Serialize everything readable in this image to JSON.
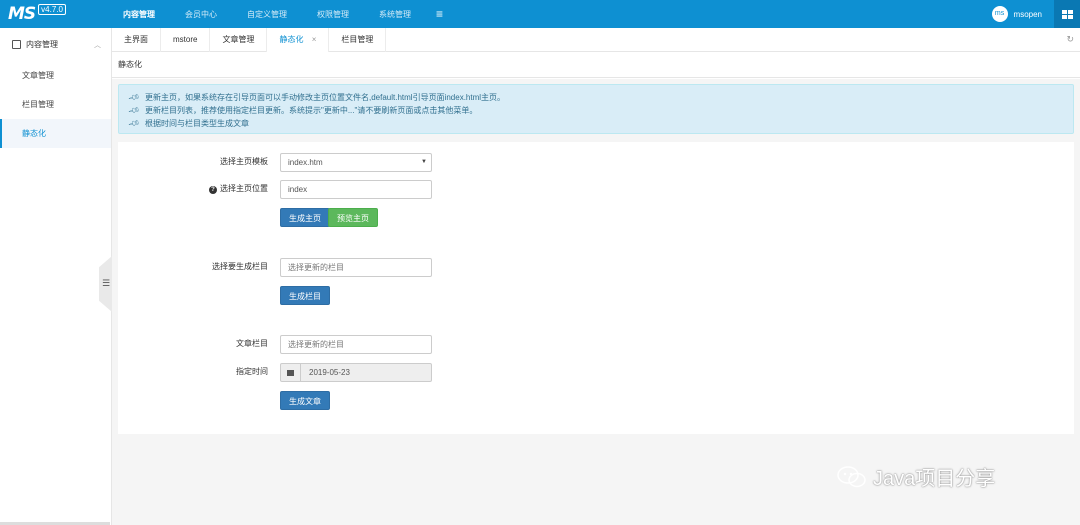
{
  "app": {
    "logo": "MS",
    "version": "v4.7.0"
  },
  "topnav": {
    "items": [
      {
        "label": "内容管理",
        "active": true
      },
      {
        "label": "会员中心"
      },
      {
        "label": "自定义管理"
      },
      {
        "label": "权限管理"
      },
      {
        "label": "系统管理"
      }
    ],
    "menu_icon": "≡"
  },
  "user": {
    "avatar_text": "ms",
    "name": "msopen"
  },
  "sidebar": {
    "header": "内容管理",
    "items": [
      {
        "label": "文章管理"
      },
      {
        "label": "栏目管理"
      },
      {
        "label": "静态化",
        "active": true
      }
    ]
  },
  "tabs": [
    {
      "label": "主界面"
    },
    {
      "label": "mstore"
    },
    {
      "label": "文章管理"
    },
    {
      "label": "静态化",
      "active": true,
      "close": "×"
    },
    {
      "label": "栏目管理"
    }
  ],
  "page": {
    "title": "静态化"
  },
  "info": [
    "更新主页，如果系统存在引导页面可以手动修改主页位置文件名,default.html引导页面index.html主页。",
    "更新栏目列表，推荐使用指定栏目更新。系统提示\"更新中...\"请不要刷新页面或点击其他菜单。",
    "根据时间与栏目类型生成文章"
  ],
  "form": {
    "home_template_label": "选择主页模板",
    "home_template_value": "index.htm",
    "home_position_label": "选择主页位置",
    "home_position_value": "index",
    "gen_home_button": "生成主页",
    "preview_home_button": "预览主页",
    "column_label": "选择要生成栏目",
    "column_placeholder": "选择更新的栏目",
    "gen_column_button": "生成栏目",
    "article_column_label": "文章栏目",
    "article_column_placeholder": "选择更新的栏目",
    "date_label": "指定时间",
    "date_value": "2019-05-23",
    "gen_article_button": "生成文章"
  },
  "watermark": {
    "text": "Java项目分享"
  },
  "colors": {
    "primary": "#0e90d2",
    "btn_blue": "#337ab7",
    "btn_green": "#5cb85c",
    "info_bg": "#d9edf7"
  }
}
